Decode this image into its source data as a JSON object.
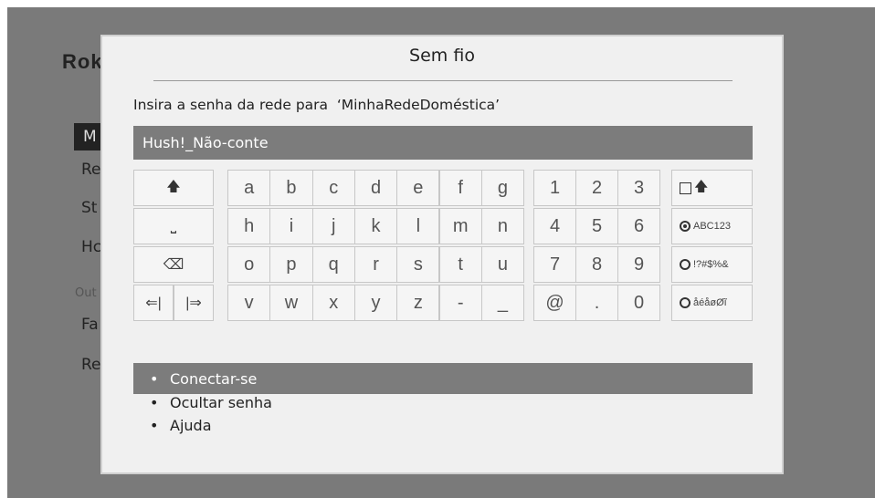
{
  "background": {
    "logo": "Rok",
    "items": [
      "M",
      "Re",
      "St",
      "Hc",
      "Fa",
      "Re"
    ],
    "section_label": "Out"
  },
  "dialog": {
    "title": "Sem fio",
    "prompt": "Insira a senha da rede para  ‘MinhaRedeDoméstica’",
    "password_value": "Hush!_Não-conte"
  },
  "keyboard": {
    "letters": [
      [
        "a",
        "b",
        "c",
        "d",
        "e",
        "f",
        "g"
      ],
      [
        "h",
        "i",
        "j",
        "k",
        "l",
        "m",
        "n"
      ],
      [
        "o",
        "p",
        "q",
        "r",
        "s",
        "t",
        "u"
      ],
      [
        "v",
        "w",
        "x",
        "y",
        "z",
        "-",
        "_"
      ]
    ],
    "numbers": [
      [
        "1",
        "2",
        "3"
      ],
      [
        "4",
        "5",
        "6"
      ],
      [
        "7",
        "8",
        "9"
      ],
      [
        "@",
        ".",
        "0"
      ]
    ],
    "controls": {
      "shift": "🡅",
      "space": "⎵",
      "backspace": "⌫",
      "cursor_left": "⇐|",
      "cursor_right": "|⇒"
    },
    "modes": {
      "caps_lock": "🡅",
      "abc123": "ABC123",
      "symbols": "!?#$%&",
      "accents": "åéåøØĩ",
      "selected": "abc123"
    }
  },
  "menu": {
    "items": [
      "Conectar-se",
      "Ocultar senha",
      "Ajuda"
    ],
    "selected_index": 0
  },
  "colors": {
    "backdrop": "#7a7a7a",
    "dialog": "#f0f0f0",
    "highlight": "#7c7c7c",
    "key": "#f5f5f5"
  }
}
